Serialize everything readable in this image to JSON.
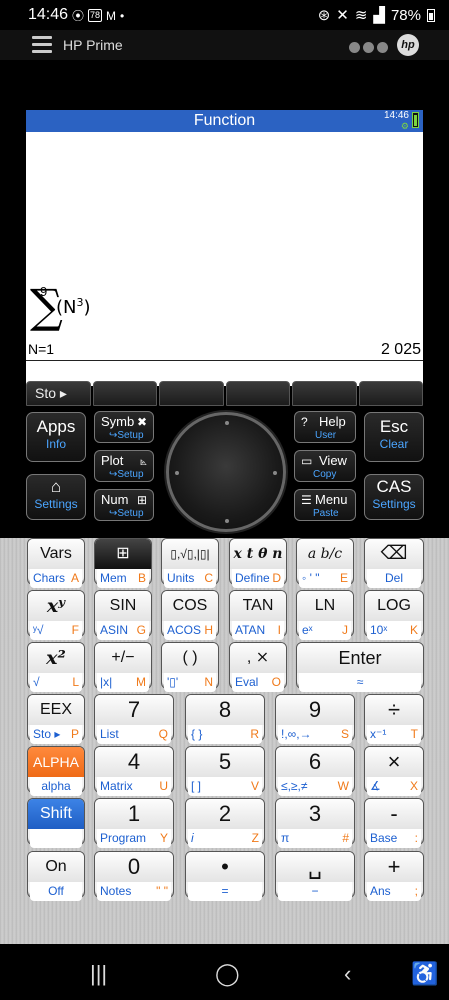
{
  "status": {
    "time": "14:46",
    "badge": "78",
    "battery_pct": "78%"
  },
  "app": {
    "title": "HP Prime",
    "logo": "hp"
  },
  "screen": {
    "title": "Function",
    "clock": "14:46",
    "expr_upper": "9",
    "expr_sigma": "∑",
    "expr_lower": "N=1",
    "expr_body": "N",
    "expr_power": "3",
    "result": "2 025"
  },
  "softkeys": [
    "Sto ▸",
    "",
    "",
    "",
    "",
    ""
  ],
  "dark_keys": {
    "apps": {
      "main": "Apps",
      "sub": "Info"
    },
    "home": {
      "main": "⌂",
      "sub": "Settings"
    },
    "symb": {
      "main": "Symb",
      "icon": "✖",
      "sub": "↪Setup"
    },
    "plot": {
      "main": "Plot",
      "icon": "⦝",
      "sub": "↪Setup"
    },
    "num": {
      "main": "Num",
      "icon": "⊞",
      "sub": "↪Setup"
    },
    "help": {
      "main": "Help",
      "icon": "?",
      "sub": "User"
    },
    "view": {
      "main": "View",
      "icon": "▭",
      "sub": "Copy"
    },
    "menu": {
      "main": "Menu",
      "icon": "☰",
      "sub": "Paste"
    },
    "esc": {
      "main": "Esc",
      "sub": "Clear"
    },
    "cas": {
      "main": "CAS",
      "sub": "Settings"
    }
  },
  "keys": [
    {
      "top": "Vars",
      "bl": "Chars",
      "br": "A"
    },
    {
      "top": "⊞",
      "bl": "Mem",
      "br": "B"
    },
    {
      "top": "▯,√▯,|▯|",
      "bl": "Units",
      "br": "C"
    },
    {
      "top": "x t θ n",
      "bl": "Define",
      "br": "D"
    },
    {
      "top": "a b/c",
      "bl": "◦ ' \"",
      "br": "E"
    },
    {
      "top": "⌫",
      "bc": "Del"
    },
    {
      "top": "xʸ",
      "bl": "ʸ√",
      "br": "F"
    },
    {
      "top": "SIN",
      "bl": "ASIN",
      "br": "G"
    },
    {
      "top": "COS",
      "bl": "ACOS",
      "br": "H"
    },
    {
      "top": "TAN",
      "bl": "ATAN",
      "br": "I"
    },
    {
      "top": "LN",
      "bl": "eˣ",
      "br": "J"
    },
    {
      "top": "LOG",
      "bl": "10ˣ",
      "br": "K"
    },
    {
      "top": "x²",
      "bl": "√",
      "br": "L"
    },
    {
      "top": "+/−",
      "bl": "|x|",
      "br": "M"
    },
    {
      "top": "( )",
      "bl": "'▯'",
      "br": "N"
    },
    {
      "top": ", ⨯",
      "bl": "Eval",
      "br": "O"
    },
    {
      "top": "Enter",
      "bc": "≈"
    },
    {
      "top": "EEX",
      "bl": "Sto ▸",
      "br": "P"
    },
    {
      "top": "7",
      "bl": "List",
      "br": "Q"
    },
    {
      "top": "8",
      "bl": "{ }",
      "br": "R"
    },
    {
      "top": "9",
      "bl": "!,∞,→",
      "br": "S"
    },
    {
      "top": "÷",
      "bl": "x⁻¹",
      "br": "T"
    },
    {
      "top": "ALPHA",
      "bc": "alpha"
    },
    {
      "top": "4",
      "bl": "Matrix",
      "br": "U"
    },
    {
      "top": "5",
      "bl": "[ ]",
      "br": "V"
    },
    {
      "top": "6",
      "bl": "≤,≥,≠",
      "br": "W"
    },
    {
      "top": "×",
      "bl": "∡",
      "br": "X"
    },
    {
      "top": "Shift",
      "bc": ""
    },
    {
      "top": "1",
      "bl": "Program",
      "br": "Y"
    },
    {
      "top": "2",
      "bl": "i",
      "br": "Z"
    },
    {
      "top": "3",
      "bl": "π",
      "br": "#"
    },
    {
      "top": "-",
      "bl": "Base",
      "br": ":"
    },
    {
      "top": "On",
      "bc": "Off"
    },
    {
      "top": "0",
      "bl": "Notes",
      "br": "\" \""
    },
    {
      "top": "•",
      "bc": "="
    },
    {
      "top": "␣",
      "bc": "−"
    },
    {
      "top": "+",
      "bl": "Ans",
      "br": ";"
    }
  ],
  "navbar": {
    "recents": "|||",
    "home": "◯",
    "back": "‹",
    "accessibility": "♿"
  }
}
